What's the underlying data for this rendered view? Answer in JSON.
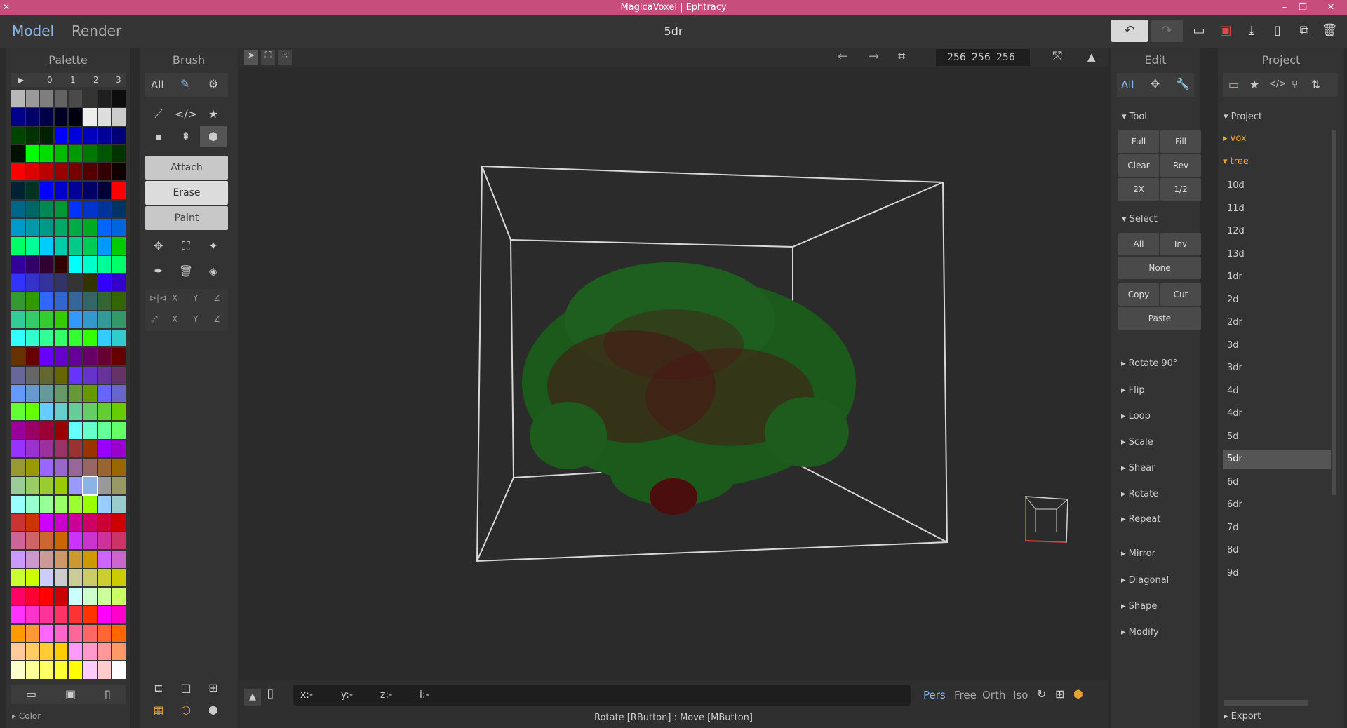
{
  "window": {
    "title": "MagicaVoxel | Ephtracy"
  },
  "topbar": {
    "mode_model": "Model",
    "mode_render": "Render",
    "file_name": "5dr"
  },
  "viewport": {
    "size_x": "256",
    "size_y": "256",
    "size_z": "256"
  },
  "palette": {
    "title": "Palette",
    "tabs": [
      "0",
      "1",
      "2",
      "3"
    ],
    "footer_label": "Color",
    "colors": [
      "#b8b8b8",
      "#9a9a9a",
      "#7e7e7e",
      "#636363",
      "#4a4a4a",
      "#333333",
      "#1f1f1f",
      "#0d0d0d",
      "#000088",
      "#000066",
      "#000044",
      "#000022",
      "#000011",
      "#eeeeee",
      "#dddddd",
      "#cccccc",
      "#004400",
      "#003300",
      "#002200",
      "#0000ff",
      "#0000dd",
      "#0000bb",
      "#000099",
      "#000077",
      "#001100",
      "#00ff00",
      "#00dd00",
      "#00bb00",
      "#009900",
      "#007700",
      "#005500",
      "#003300",
      "#ff0000",
      "#dd0000",
      "#bb0000",
      "#990000",
      "#770000",
      "#550000",
      "#330000",
      "#110000",
      "#002233",
      "#003322",
      "#0000ff",
      "#0000cc",
      "#000099",
      "#000066",
      "#000033",
      "#ff0000",
      "#006688",
      "#006666",
      "#008855",
      "#009933",
      "#0033ff",
      "#0033cc",
      "#003399",
      "#003366",
      "#0099cc",
      "#0099aa",
      "#009988",
      "#00aa66",
      "#00aa44",
      "#00aa22",
      "#0066ff",
      "#0066dd",
      "#00ff66",
      "#00ff99",
      "#00ccff",
      "#00ccaa",
      "#00cc88",
      "#00cc55",
      "#0099ff",
      "#00cc00",
      "#330099",
      "#330066",
      "#330033",
      "#330000",
      "#00ffff",
      "#00ffcc",
      "#00ff99",
      "#00ff66",
      "#3333ff",
      "#3333cc",
      "#333399",
      "#333366",
      "#333333",
      "#333300",
      "#3300ff",
      "#3300cc",
      "#339933",
      "#339900",
      "#3366ff",
      "#3366cc",
      "#336699",
      "#336666",
      "#336633",
      "#336600",
      "#33cc99",
      "#33cc66",
      "#33cc33",
      "#33cc00",
      "#3399ff",
      "#3399cc",
      "#339999",
      "#339966",
      "#33ffff",
      "#33ffcc",
      "#33ff99",
      "#33ff66",
      "#33ff33",
      "#33ff00",
      "#33ccff",
      "#33cccc",
      "#663300",
      "#660000",
      "#6600ff",
      "#6600cc",
      "#660099",
      "#660066",
      "#660033",
      "#660000",
      "#666699",
      "#666666",
      "#666633",
      "#666600",
      "#6633ff",
      "#6633cc",
      "#663399",
      "#663366",
      "#6699ff",
      "#6699cc",
      "#669999",
      "#669966",
      "#669933",
      "#669900",
      "#6666ff",
      "#6666cc",
      "#66ff33",
      "#66ff00",
      "#66ccff",
      "#66cccc",
      "#66cc99",
      "#66cc66",
      "#66cc33",
      "#66cc00",
      "#990099",
      "#990066",
      "#990033",
      "#990000",
      "#66ffff",
      "#66ffcc",
      "#66ff99",
      "#66ff66",
      "#9933ff",
      "#9933cc",
      "#993399",
      "#993366",
      "#993333",
      "#993300",
      "#9900ff",
      "#9900cc",
      "#999933",
      "#999900",
      "#9966ff",
      "#9966cc",
      "#996699",
      "#996666",
      "#996633",
      "#996600",
      "#99cc99",
      "#99cc66",
      "#99cc33",
      "#99cc00",
      "#9999ff",
      "#9999cc",
      "#999999",
      "#999966",
      "#99ffff",
      "#99ffcc",
      "#99ff99",
      "#99ff66",
      "#99ff33",
      "#99ff00",
      "#99ccff",
      "#99cccc",
      "#cc3333",
      "#cc3300",
      "#cc00ff",
      "#cc00cc",
      "#cc0099",
      "#cc0066",
      "#cc0033",
      "#cc0000",
      "#cc6699",
      "#cc6666",
      "#cc6633",
      "#cc6600",
      "#cc33ff",
      "#cc33cc",
      "#cc3399",
      "#cc3366",
      "#cc99ff",
      "#cc99cc",
      "#cc9999",
      "#cc9966",
      "#cc9933",
      "#cc9900",
      "#cc66ff",
      "#cc66cc",
      "#ccff33",
      "#ccff00",
      "#ccccff",
      "#cccccc",
      "#cccc99",
      "#cccc66",
      "#cccc33",
      "#cccc00",
      "#ff0066",
      "#ff0033",
      "#ff0000",
      "#cc0000",
      "#ccffff",
      "#ccffcc",
      "#ccff99",
      "#ccff66",
      "#ff33ff",
      "#ff33cc",
      "#ff3399",
      "#ff3366",
      "#ff3333",
      "#ff3300",
      "#ff00ff",
      "#ff00cc",
      "#ff9900",
      "#ff9933",
      "#ff66ff",
      "#ff66cc",
      "#ff6699",
      "#ff6666",
      "#ff6633",
      "#ff6600",
      "#ffcc99",
      "#ffcc66",
      "#ffcc33",
      "#ffcc00",
      "#ff99ff",
      "#ff99cc",
      "#ff9999",
      "#ff9966",
      "#ffffcc",
      "#ffff99",
      "#ffff66",
      "#ffff33",
      "#ffff00",
      "#ffccff",
      "#ffcccc",
      "#ffffff"
    ]
  },
  "brush": {
    "title": "Brush",
    "filter_all": "All",
    "modes": [
      "Attach",
      "Erase",
      "Paint"
    ],
    "axis": [
      "X",
      "Y",
      "Z"
    ]
  },
  "statusbar": {
    "x": "x:-",
    "y": "y:-",
    "z": "z:-",
    "i": "i:-",
    "views": [
      "Pers",
      "Free",
      "Orth",
      "Iso"
    ],
    "hint": "Rotate [RButton] : Move [MButton]"
  },
  "edit": {
    "title": "Edit",
    "filter_all": "All",
    "tool_section": "Tool",
    "tool_buttons": [
      "Full",
      "Fill",
      "Clear",
      "Rev",
      "2X",
      "1/2"
    ],
    "select_section": "Select",
    "select_buttons": [
      "All",
      "Inv"
    ],
    "none": "None",
    "copy": "Copy",
    "cut": "Cut",
    "paste": "Paste",
    "ops": [
      "Rotate 90°",
      "Flip",
      "Loop",
      "Scale",
      "Shear",
      "Rotate",
      "Repeat"
    ],
    "ops2": [
      "Mirror",
      "Diagonal",
      "Shape",
      "Modify"
    ]
  },
  "project": {
    "title": "Project",
    "section": "Project",
    "folders": [
      "vox",
      "tree"
    ],
    "files": [
      "10d",
      "11d",
      "12d",
      "13d",
      "1dr",
      "2d",
      "2dr",
      "3d",
      "3dr",
      "4d",
      "4dr",
      "5d",
      "5dr",
      "6d",
      "6dr",
      "7d",
      "8d",
      "9d"
    ],
    "selected": "5dr",
    "export": "Export"
  }
}
